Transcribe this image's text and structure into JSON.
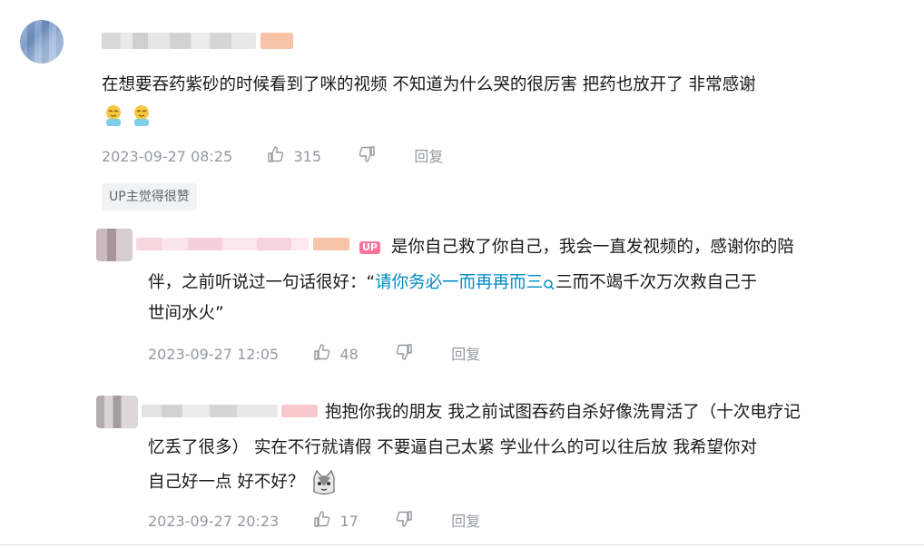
{
  "main_comment": {
    "text_line1": "在想要吞药紫砂的时候看到了咪的视频 不知道为什么哭的很厉害 把药也放开了 非常感谢",
    "emoji_1": "doge-emoji",
    "emoji_2": "doge-emoji",
    "time": "2023-09-27 08:25",
    "likes": "315",
    "reply_label": "回复",
    "tag": "UP主觉得很赞"
  },
  "replies": [
    {
      "badge": "UP",
      "text_plain1": "是你自己救了你自己，我会一直发视频的，感谢你的陪",
      "text_plain2": "伴，之前听说过一句话很好：“",
      "link_text": "请你务必一而再再而三",
      "text_plain3": "三而不竭千次万次救自己于",
      "text_plain4": "世间水火”",
      "time": "2023-09-27 12:05",
      "likes": "48",
      "reply_label": "回复"
    },
    {
      "text_line1": "抱抱你我的朋友 我之前试图吞药自杀好像洗胃活了（十次电疗记",
      "text_line2": "忆丢了很多） 实在不行就请假 不要逼自己太紧 学业什么的可以往后放 我希望你对",
      "text_line3": "自己好一点 好不好？",
      "emoji": "cat-emoji",
      "time": "2023-09-27 20:23",
      "likes": "17",
      "reply_label": "回复"
    }
  ],
  "colors": {
    "text": "#18191c",
    "meta": "#9499a0",
    "link": "#008ac5",
    "up_badge": "#fb7299"
  }
}
